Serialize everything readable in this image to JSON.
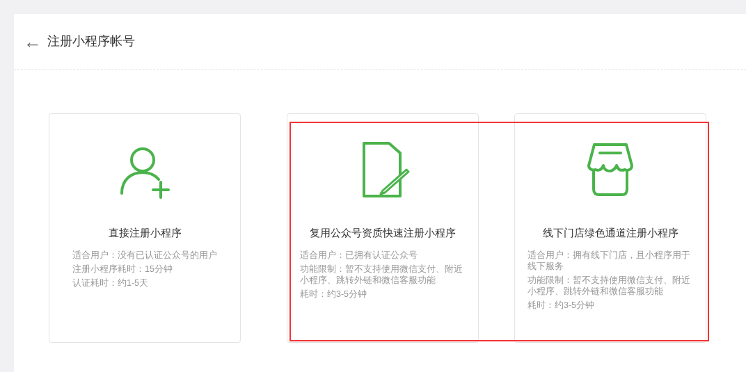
{
  "header": {
    "back": "←",
    "title": "注册小程序帐号"
  },
  "cards": [
    {
      "kind": "person",
      "title": "直接注册小程序",
      "lines": [
        "适合用户：没有已认证公众号的用户",
        "注册小程序耗时：15分钟",
        "认证耗时：约1-5天"
      ],
      "highlighted": false
    },
    {
      "kind": "document",
      "title": "复用公众号资质快速注册小程序",
      "lines": [
        "适合用户：已拥有认证公众号",
        "功能限制：暂不支持使用微信支付、附近小程序、跳转外链和微信客服功能",
        "耗时：约3-5分钟"
      ],
      "highlighted": true
    },
    {
      "kind": "store",
      "title": "线下门店绿色通道注册小程序",
      "lines": [
        "适合用户：拥有线下门店，且小程序用于线下服务",
        "功能限制：暂不支持使用微信支付、附近小程序、跳转外链和微信客服功能",
        "耗时：约3-5分钟"
      ],
      "highlighted": true
    }
  ]
}
